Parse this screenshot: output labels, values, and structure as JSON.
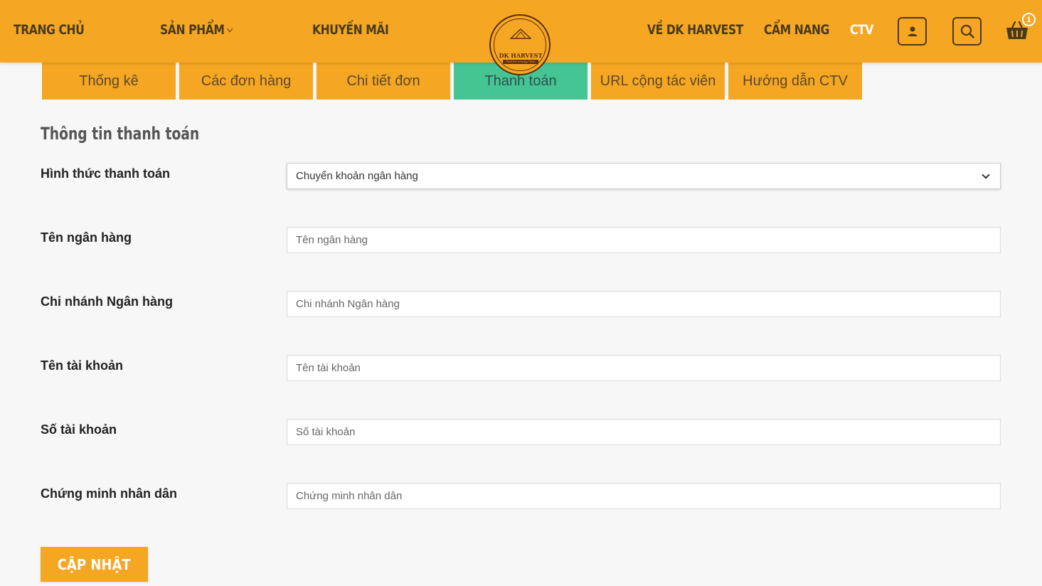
{
  "header": {
    "nav_left": [
      {
        "label": "TRANG CHỦ"
      },
      {
        "label": "SẢN PHẨM"
      },
      {
        "label": "KHUYẾN MÃI"
      }
    ],
    "nav_right": [
      {
        "label": "VỀ DK HARVEST"
      },
      {
        "label": "CẨM NANG"
      },
      {
        "label": "CTV"
      }
    ],
    "logo_text": "DK HARVEST",
    "logo_tagline": "Positive energy from nature",
    "cart_count": "1",
    "icons": [
      "user-icon",
      "search-icon",
      "cart-icon"
    ],
    "colors": {
      "primary": "#f5a623",
      "active_tab": "#46c594",
      "nav_active": "#ffffff"
    }
  },
  "tabs": [
    {
      "label": "Thống kê"
    },
    {
      "label": "Các đơn hàng"
    },
    {
      "label": "Chi tiết đơn"
    },
    {
      "label": "Thanh toán"
    },
    {
      "label": "URL cộng tác viên"
    },
    {
      "label": "Hướng dẫn CTV"
    }
  ],
  "form": {
    "title": "Thông tin thanh toán",
    "payment_method_label": "Hình thức thanh toán",
    "payment_method_value": "Chuyển khoản ngân hàng",
    "fields": [
      {
        "label": "Tên ngân hàng",
        "placeholder": "Tên ngân hàng"
      },
      {
        "label": "Chi nhánh Ngân hàng",
        "placeholder": "Chi nhánh Ngân hàng"
      },
      {
        "label": "Tên tài khoản",
        "placeholder": "Tên tài khoản"
      },
      {
        "label": "Số tài khoản",
        "placeholder": "Số tài khoản"
      },
      {
        "label": "Chứng minh nhân dân",
        "placeholder": "Chứng minh nhân dân"
      }
    ],
    "submit_label": "CẬP NHẬT"
  }
}
